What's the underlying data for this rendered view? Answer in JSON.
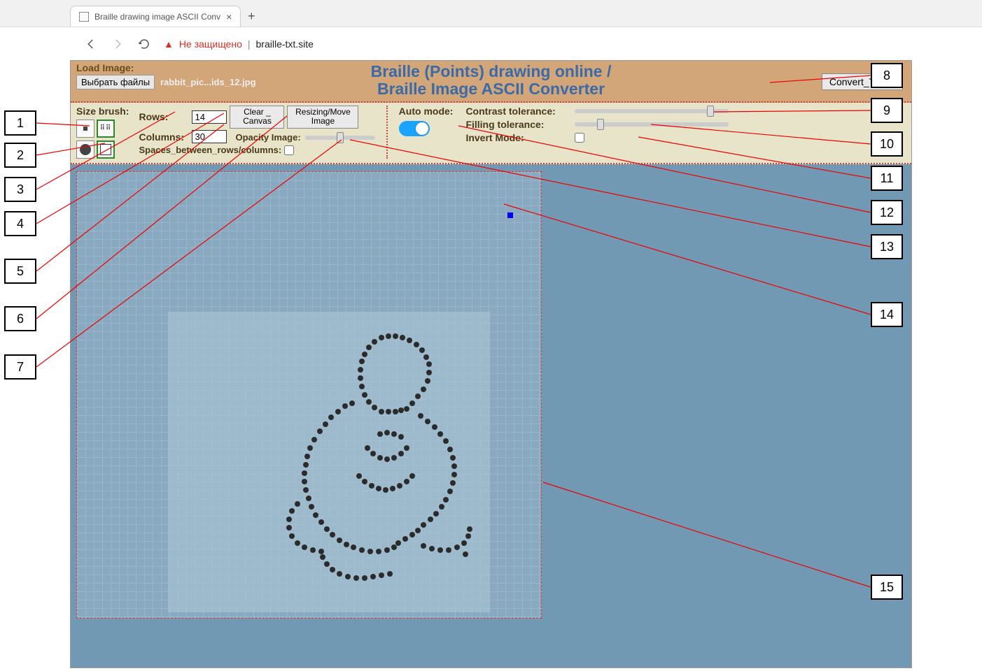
{
  "browser": {
    "tab_title": "Braille drawing image ASCII Conv",
    "warn_text": "Не защищено",
    "url_host": "braille-txt.site"
  },
  "header": {
    "load_label": "Load Image:",
    "file_btn": "Выбрать файлы",
    "file_name": "rabbit_pic...ids_12.jpg",
    "title_line1": "Braille (Points) drawing online /",
    "title_line2": "Braille Image ASCII Converter",
    "convert_btn": "Convert_To_txt"
  },
  "toolbar": {
    "size_brush": "Size brush:",
    "rows_label": "Rows:",
    "rows_value": "14",
    "columns_label": "Columns:",
    "columns_value": "30",
    "clear_btn": "Clear _\nCanvas",
    "resize_btn": "Resizing/Move\nImage",
    "opacity_label": "Opacity Image:",
    "spaces_label": "Spaces_between_rows/columns:",
    "auto_mode": "Auto mode:",
    "contrast_label": "Contrast tolerance:",
    "filling_label": "Filling tolerance:",
    "invert_label": "Invert Mode:"
  },
  "annotations": {
    "n1": "1",
    "n2": "2",
    "n3": "3",
    "n4": "4",
    "n5": "5",
    "n6": "6",
    "n7": "7",
    "n8": "8",
    "n9": "9",
    "n10": "10",
    "n11": "11",
    "n12": "12",
    "n13": "13",
    "n14": "14",
    "n15": "15"
  }
}
